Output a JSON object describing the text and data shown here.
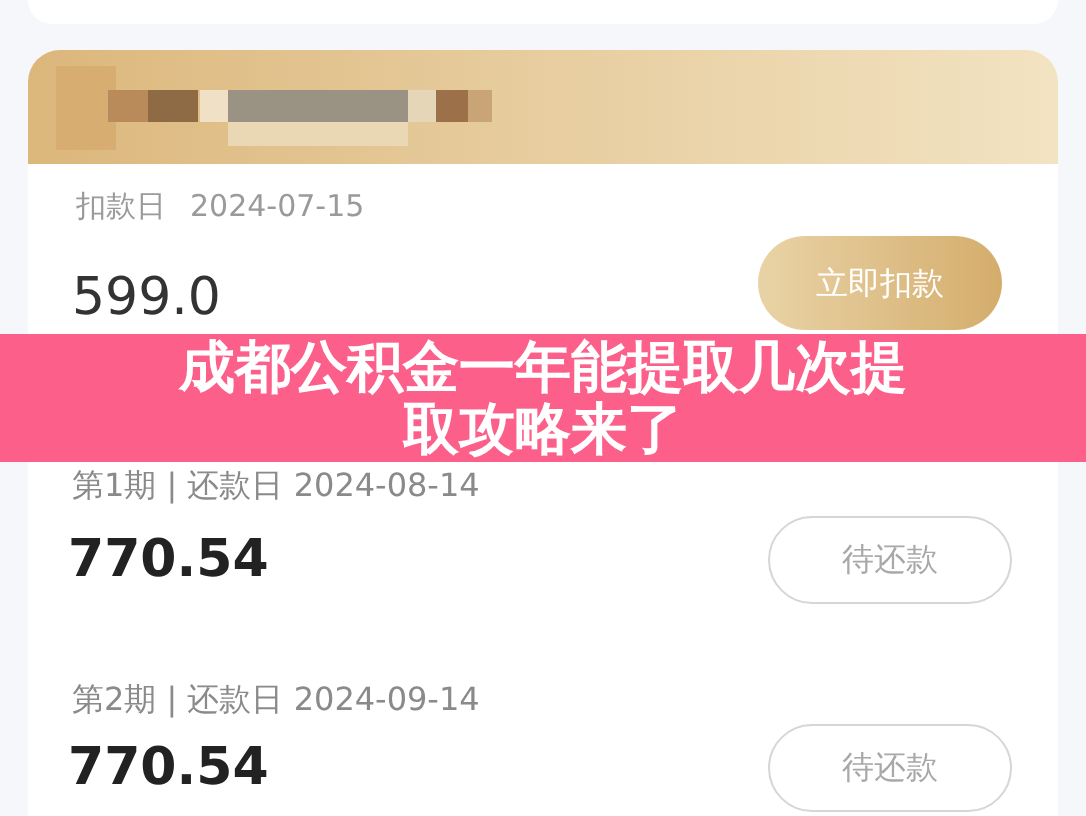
{
  "plan_card": {
    "deduction_date_label": "扣款日",
    "deduction_date": "2024-07-15",
    "amount": "599.0",
    "button": "立即扣款"
  },
  "installments": [
    {
      "label": "第1期 | 还款日 2024-08-14",
      "amount": "770.54",
      "button": "待还款"
    },
    {
      "label": "第2期 | 还款日 2024-09-14",
      "amount": "770.54",
      "button": "待还款"
    }
  ],
  "banner": {
    "title": "成都公积金一年能提取几次提取攻略来了"
  }
}
